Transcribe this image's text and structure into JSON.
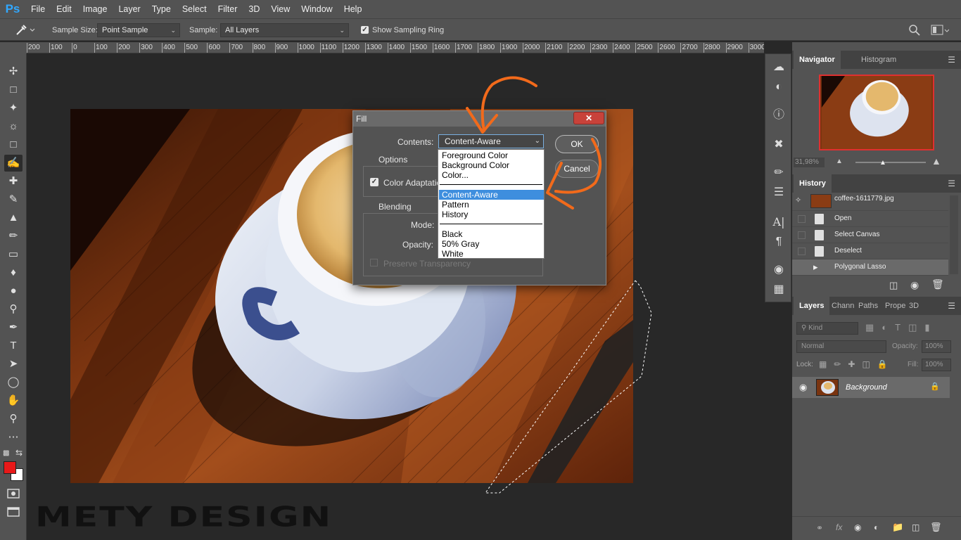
{
  "app": {
    "logo": "Ps"
  },
  "menu": [
    "File",
    "Edit",
    "Image",
    "Layer",
    "Type",
    "Select",
    "Filter",
    "3D",
    "View",
    "Window",
    "Help"
  ],
  "options_bar": {
    "sample_size_label": "Sample Size:",
    "sample_size_value": "Point Sample",
    "sample_label": "Sample:",
    "sample_value": "All Layers",
    "show_sampling_ring_label": "Show Sampling Ring",
    "show_sampling_ring_checked": true
  },
  "ruler": {
    "ticks": [
      "200",
      "100",
      "0",
      "100",
      "200",
      "300",
      "400",
      "500",
      "600",
      "700",
      "800",
      "900",
      "1000",
      "1100",
      "1200",
      "1300",
      "1400",
      "1500",
      "1600",
      "1700",
      "1800",
      "1900",
      "2000",
      "2100",
      "2200",
      "2300",
      "2400",
      "2500",
      "2600",
      "2700",
      "2800",
      "2900",
      "3000"
    ]
  },
  "tools": [
    "move-tool-icon",
    "marquee-tool-icon",
    "lasso-tool-icon",
    "quick-select-tool-icon",
    "crop-tool-icon",
    "eyedropper-tool-icon",
    "healing-brush-tool-icon",
    "brush-tool-icon",
    "clone-stamp-tool-icon",
    "history-brush-tool-icon",
    "eraser-tool-icon",
    "paint-bucket-tool-icon",
    "blur-tool-icon",
    "dodge-tool-icon",
    "pen-tool-icon",
    "type-tool-icon",
    "path-select-tool-icon",
    "ellipse-tool-icon",
    "hand-tool-icon",
    "zoom-tool-icon",
    "more-tools-icon"
  ],
  "colors": {
    "foreground": "#e81919",
    "background": "#ffffff",
    "ui_bg": "#535353",
    "canvas_bg": "#282828",
    "annotation": "#f26a1b",
    "selection": "#3e8ede"
  },
  "fill_dialog": {
    "title": "Fill",
    "contents_label": "Contents:",
    "contents_value": "Content-Aware",
    "ok_label": "OK",
    "cancel_label": "Cancel",
    "options_title": "Options",
    "color_adaptation_label": "Color Adaptation",
    "blending_title": "Blending",
    "mode_label": "Mode:",
    "opacity_label": "Opacity:",
    "preserve_transparency_label": "Preserve Transparency",
    "dropdown_items": {
      "foreground": "Foreground Color",
      "background": "Background Color",
      "color": "Color...",
      "content_aware": "Content-Aware",
      "pattern": "Pattern",
      "history": "History",
      "black": "Black",
      "gray": "50% Gray",
      "white": "White"
    }
  },
  "navigator": {
    "tabs": [
      "Navigator",
      "Histogram"
    ],
    "zoom": "31,98%"
  },
  "history": {
    "tab": "History",
    "snapshot": "coffee-1611779.jpg",
    "items": [
      "Open",
      "Select Canvas",
      "Deselect",
      "Polygonal Lasso"
    ]
  },
  "layers": {
    "tabs": [
      "Layers",
      "Chann",
      "Paths",
      "Prope",
      "3D"
    ],
    "kind_label": "Kind",
    "blend_mode": "Normal",
    "opacity_label": "Opacity:",
    "opacity_value": "100%",
    "lock_label": "Lock:",
    "fill_label": "Fill:",
    "fill_value": "100%",
    "layer_name": "Background"
  },
  "watermark": "METY DESIGN"
}
